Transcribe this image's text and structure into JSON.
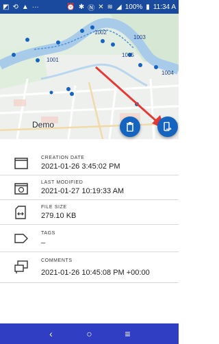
{
  "status_bar": {
    "left_icons": [
      "gallery-icon",
      "sync-icon",
      "warning-icon",
      "more-icon"
    ],
    "left_symbols": [
      "◩",
      "⟲",
      "▲",
      "···"
    ],
    "right_icons": [
      "alarm-icon",
      "bluetooth-icon",
      "nfc-icon",
      "mute-icon",
      "wifi-icon",
      "signal-icon"
    ],
    "battery": "100%",
    "time": "11:34 A"
  },
  "map": {
    "title": "Demo",
    "markers": [
      "1001",
      "1002",
      "1003",
      "1004",
      "1005"
    ],
    "accent": "#1565c0",
    "river_color": "#a8cbea",
    "arrow_color": "#e53935"
  },
  "fab": {
    "delete_icon": "trash-icon",
    "export_icon": "export-device-icon"
  },
  "info": {
    "creation_date": {
      "label": "CREATION DATE",
      "value": "2021-01-26 3:45:02 PM"
    },
    "last_modified": {
      "label": "LAST MODIFIED",
      "value": "2021-01-27 10:19:33 AM"
    },
    "file_size": {
      "label": "FILE SIZE",
      "value": "279.10 KB"
    },
    "tags": {
      "label": "TAGS",
      "value": "_"
    },
    "comments": {
      "label": "COMMENTS",
      "value": "2021-01-26 10:45:08 PM +00:00"
    }
  },
  "nav": {
    "back": "‹",
    "home": "○",
    "recents": "≡"
  }
}
